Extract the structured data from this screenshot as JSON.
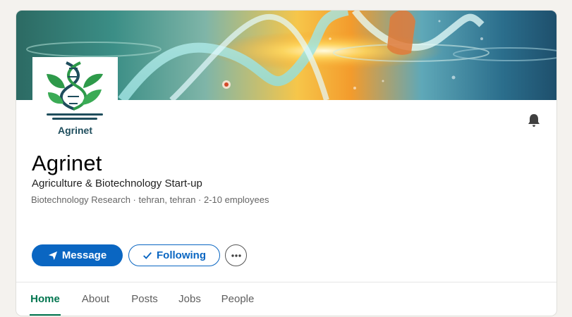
{
  "company": {
    "logo_text": "Agrinet",
    "name": "Agrinet",
    "tagline": "Agriculture & Biotechnology Start-up",
    "meta": {
      "industry": "Biotechnology Research",
      "location": "tehran, tehran",
      "size": "2-10 employees",
      "separator": " · "
    }
  },
  "actions": {
    "message_label": "Message",
    "following_label": "Following",
    "more_icon": "more-horizontal-icon"
  },
  "tabs": [
    {
      "label": "Home",
      "active": true
    },
    {
      "label": "About",
      "active": false
    },
    {
      "label": "Posts",
      "active": false
    },
    {
      "label": "Jobs",
      "active": false
    },
    {
      "label": "People",
      "active": false
    }
  ],
  "icons": {
    "bell": "bell-icon",
    "send": "send-icon",
    "check": "check-icon"
  },
  "colors": {
    "primary": "#0a66c2",
    "active_tab": "#01754f",
    "logo_green": "#2e9a4a",
    "logo_dark": "#1e4d5c"
  }
}
